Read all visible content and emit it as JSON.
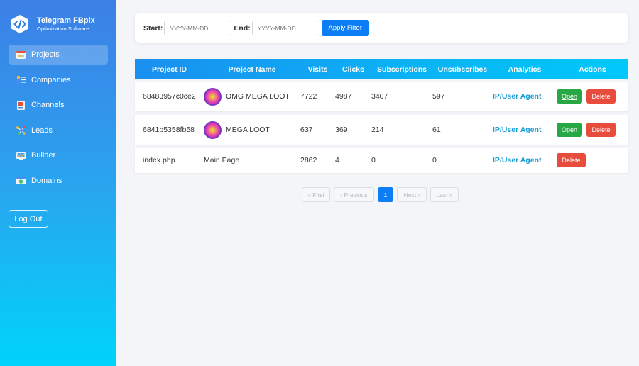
{
  "brand": {
    "title": "Telegram FBpix",
    "subtitle": "Optimization Software"
  },
  "sidebar": {
    "items": [
      {
        "label": "Projects",
        "icon": "projects-icon",
        "active": true
      },
      {
        "label": "Companies",
        "icon": "companies-icon",
        "active": false
      },
      {
        "label": "Channels",
        "icon": "channels-icon",
        "active": false
      },
      {
        "label": "Leads",
        "icon": "leads-icon",
        "active": false
      },
      {
        "label": "Builder",
        "icon": "builder-icon",
        "active": false
      },
      {
        "label": "Domains",
        "icon": "domains-icon",
        "active": false
      }
    ],
    "logout_label": "Log Out"
  },
  "filter": {
    "start_label": "Start:",
    "start_placeholder": "YYYY-MM-DD",
    "end_label": "End:",
    "end_placeholder": "YYYY-MM-DD",
    "apply_label": "Apply Filter"
  },
  "table": {
    "headers": {
      "id": "Project ID",
      "name": "Project Name",
      "visits": "Visits",
      "clicks": "Clicks",
      "subs": "Subscriptions",
      "unsubs": "Unsubscribes",
      "analytics": "Analytics",
      "actions": "Actions"
    },
    "rows": [
      {
        "id": "68483957c0ce2",
        "name": "OMG MEGA LOOT",
        "visits": "7722",
        "clicks": "4987",
        "subs": "3407",
        "unsubs": "597",
        "analytics": "IP/User Agent",
        "open": "Open",
        "delete": "Delete"
      },
      {
        "id": "6841b5358fb58",
        "name": "MEGA LOOT",
        "visits": "637",
        "clicks": "369",
        "subs": "214",
        "unsubs": "61",
        "analytics": "IP/User Agent",
        "open": "Open",
        "delete": "Delete"
      },
      {
        "id": "index.php",
        "name": "Main Page",
        "visits": "2862",
        "clicks": "4",
        "subs": "0",
        "unsubs": "0",
        "analytics": "IP/User Agent",
        "delete": "Delete"
      }
    ]
  },
  "pagination": {
    "first": "« First",
    "prev": "‹ Previous",
    "current": "1",
    "next": "Next ›",
    "last": "Last »"
  },
  "colors": {
    "accent": "#0d7df5",
    "open": "#28a745",
    "delete": "#e74c3c",
    "link": "#1a9dd6"
  }
}
